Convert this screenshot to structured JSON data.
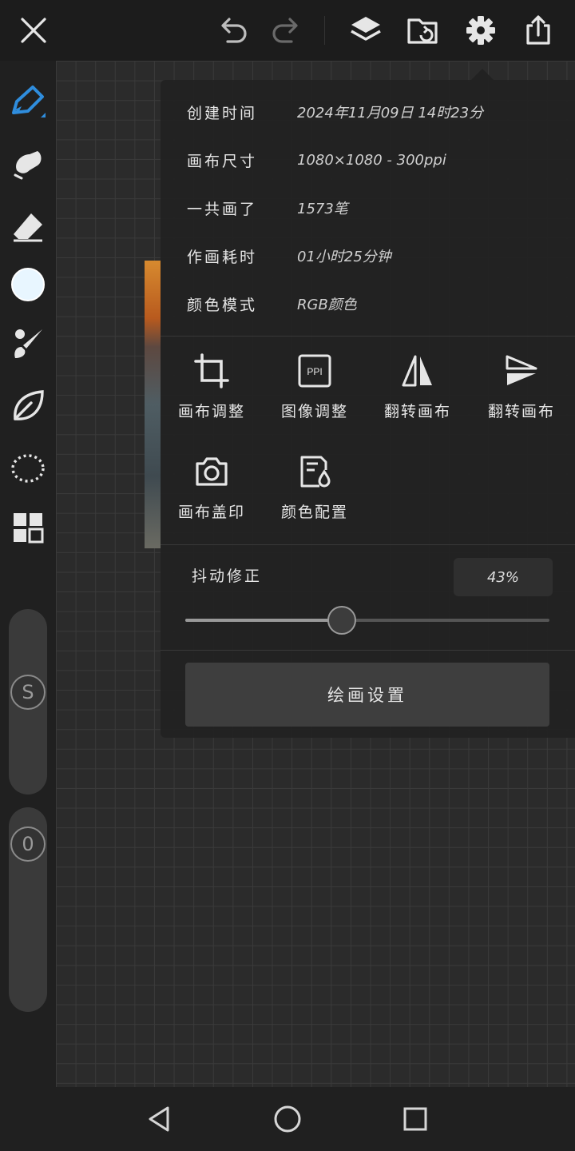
{
  "topbar": {
    "icons": [
      "close-icon",
      "undo-icon",
      "redo-icon",
      "layers-icon",
      "folder-icon",
      "settings-icon",
      "share-icon"
    ]
  },
  "toolbar": {
    "tools": [
      "pen-icon",
      "smudge-icon",
      "eraser-icon",
      "color-swatch",
      "brush-icon",
      "leaf-icon",
      "lasso-icon",
      "grid-icon"
    ],
    "active_color": "#e8f6ff",
    "accent": "#2f8ddd",
    "size_knob_label": "S",
    "opacity_knob_label": "0"
  },
  "settings": {
    "info": [
      {
        "key": "创建时间",
        "value": "2024年11月09日 14时23分"
      },
      {
        "key": "画布尺寸",
        "value": "1080×1080 - 300ppi"
      },
      {
        "key": "一共画了",
        "value": "1573笔"
      },
      {
        "key": "作画耗时",
        "value": "01小时25分钟"
      },
      {
        "key": "颜色模式",
        "value": "RGB颜色"
      }
    ],
    "actions": [
      {
        "label": "画布调整",
        "icon": "crop-icon"
      },
      {
        "label": "图像调整",
        "icon": "ppi-icon",
        "icon_text": "PPI"
      },
      {
        "label": "翻转画布",
        "icon": "flip-horizontal-icon"
      },
      {
        "label": "翻转画布",
        "icon": "flip-vertical-icon"
      },
      {
        "label": "画布盖印",
        "icon": "camera-icon"
      },
      {
        "label": "颜色配置",
        "icon": "color-profile-icon"
      }
    ],
    "stabilizer": {
      "label": "抖动修正",
      "value_text": "43%",
      "value": 0.43
    },
    "drawing_settings_label": "绘画设置"
  },
  "navbar": {
    "icons": [
      "back-icon",
      "home-icon",
      "recents-icon"
    ]
  }
}
